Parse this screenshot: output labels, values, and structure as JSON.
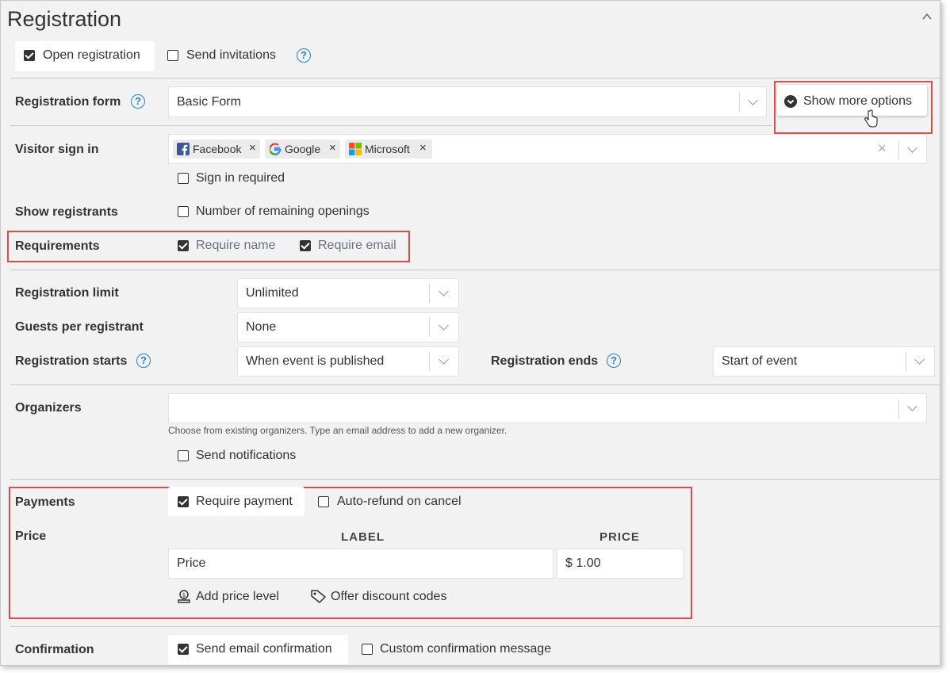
{
  "section_title": "Registration",
  "top_options": {
    "open_registration": "Open registration",
    "send_invitations": "Send invitations"
  },
  "registration_form": {
    "label": "Registration form",
    "value": "Basic Form",
    "show_more": "Show more options"
  },
  "visitor_sign_in": {
    "label": "Visitor sign in",
    "providers": [
      "Facebook",
      "Google",
      "Microsoft"
    ],
    "sign_in_required": "Sign in required"
  },
  "show_registrants": {
    "label": "Show registrants",
    "option": "Number of remaining openings"
  },
  "requirements": {
    "label": "Requirements",
    "require_name": "Require name",
    "require_email": "Require email"
  },
  "limits": {
    "registration_limit_label": "Registration limit",
    "registration_limit_value": "Unlimited",
    "guests_label": "Guests per registrant",
    "guests_value": "None",
    "starts_label": "Registration starts",
    "starts_value": "When event is published",
    "ends_label": "Registration ends",
    "ends_value": "Start of event"
  },
  "organizers": {
    "label": "Organizers",
    "hint": "Choose from existing organizers. Type an email address to add a new organizer.",
    "send_notifications": "Send notifications"
  },
  "payments": {
    "label": "Payments",
    "require_payment": "Require payment",
    "auto_refund": "Auto-refund on cancel",
    "price_label": "Price",
    "col_label": "LABEL",
    "col_price": "PRICE",
    "row_label": "Price",
    "row_price": "$ 1.00",
    "add_price_level": "Add price level",
    "offer_discount": "Offer discount codes"
  },
  "confirmation": {
    "label": "Confirmation",
    "send_email": "Send email confirmation",
    "custom_message": "Custom confirmation message"
  },
  "colors": {
    "highlight": "#e24a4a",
    "help_blue": "#2a7fd4"
  }
}
